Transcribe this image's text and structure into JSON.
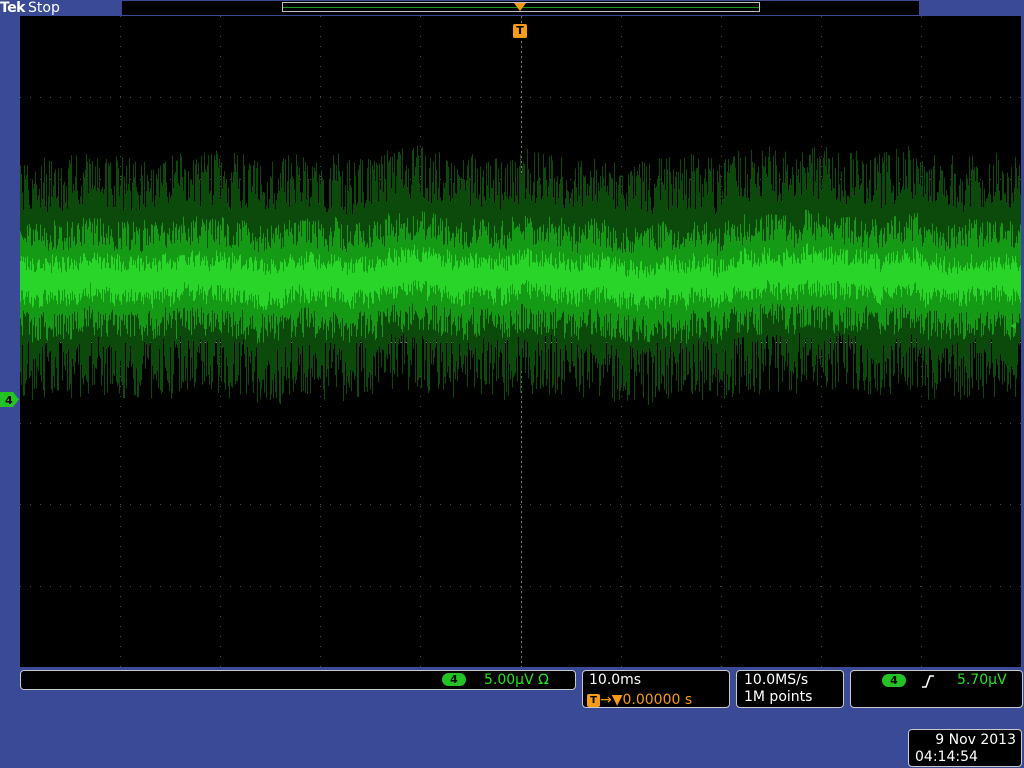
{
  "header": {
    "brand": "Tek",
    "acq_state": "Stop"
  },
  "trigger_marker": {
    "label": "T"
  },
  "channel_marker": {
    "label": "4"
  },
  "channel_readout": {
    "channel": "4",
    "scale": "5.00µV Ω"
  },
  "horizontal_readout": {
    "time_per_div": "10.0ms",
    "trigger_icon": "T",
    "position": "→▼0.00000 s"
  },
  "acquisition_readout": {
    "sample_rate": "10.0MS/s",
    "record_length": "1M points"
  },
  "trigger_readout": {
    "source": "4",
    "slope_icon": "rising-edge-icon",
    "level": "5.70µV"
  },
  "datetime": {
    "date": "9 Nov 2013",
    "time": "04:14:54"
  },
  "colors": {
    "background": "#3a4a96",
    "trace": "#22c322",
    "trigger": "#f79a16"
  },
  "waveform": {
    "record_fill_fraction": 1.0
  }
}
